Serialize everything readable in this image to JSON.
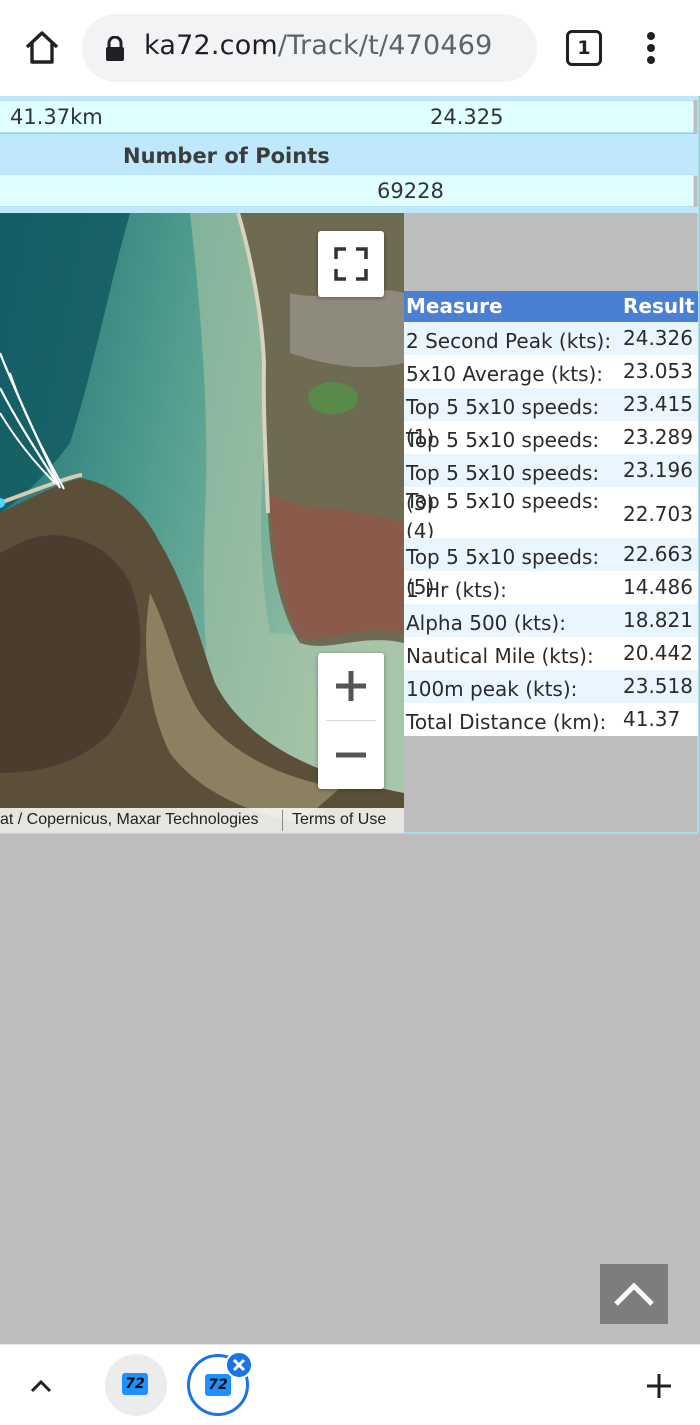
{
  "browser": {
    "url_host": "ka72.com",
    "url_path": "/Track/t/470469",
    "tab_count": "1"
  },
  "summary": {
    "distance_value": "41.37km",
    "speed_value": "24.325",
    "points_header": "Number of Points",
    "points_value": "69228"
  },
  "map": {
    "attribution": "at / Copernicus, Maxar Technologies",
    "terms_label": "Terms of Use",
    "zoom_in_label": "+",
    "zoom_out_label": "−"
  },
  "results": {
    "headers": {
      "measure": "Measure",
      "result": "Result"
    },
    "rows": [
      {
        "measure": "2 Second Peak (kts):",
        "result": "24.326"
      },
      {
        "measure": "5x10 Average (kts):",
        "result": "23.053"
      },
      {
        "measure": "Top 5 5x10 speeds: (1)",
        "result": "23.415"
      },
      {
        "measure": "Top 5 5x10 speeds: (2)",
        "result": "23.289"
      },
      {
        "measure": "Top 5 5x10 speeds: (3)",
        "result": "23.196"
      },
      {
        "measure": "Top 5 5x10 speeds: (4)",
        "result": "22.703"
      },
      {
        "measure": "Top 5 5x10 speeds: (5)",
        "result": "22.663"
      },
      {
        "measure": "1 Hr (kts):",
        "result": "14.486"
      },
      {
        "measure": "Alpha 500 (kts):",
        "result": "18.821"
      },
      {
        "measure": "Nautical Mile (kts):",
        "result": "20.442"
      },
      {
        "measure": "100m peak (kts):",
        "result": "23.518"
      },
      {
        "measure": "Total Distance (km):",
        "result": "41.37"
      }
    ]
  },
  "tabs": [
    {
      "favicon_text": "72"
    },
    {
      "favicon_text": "72"
    }
  ],
  "icons": {
    "home": "home-icon",
    "lock": "lock-icon",
    "menu": "more-vert-icon",
    "fullscreen": "fullscreen-icon",
    "scroll_top": "chevron-up-icon",
    "add_tab": "plus-icon",
    "close_tab": "close-icon"
  }
}
